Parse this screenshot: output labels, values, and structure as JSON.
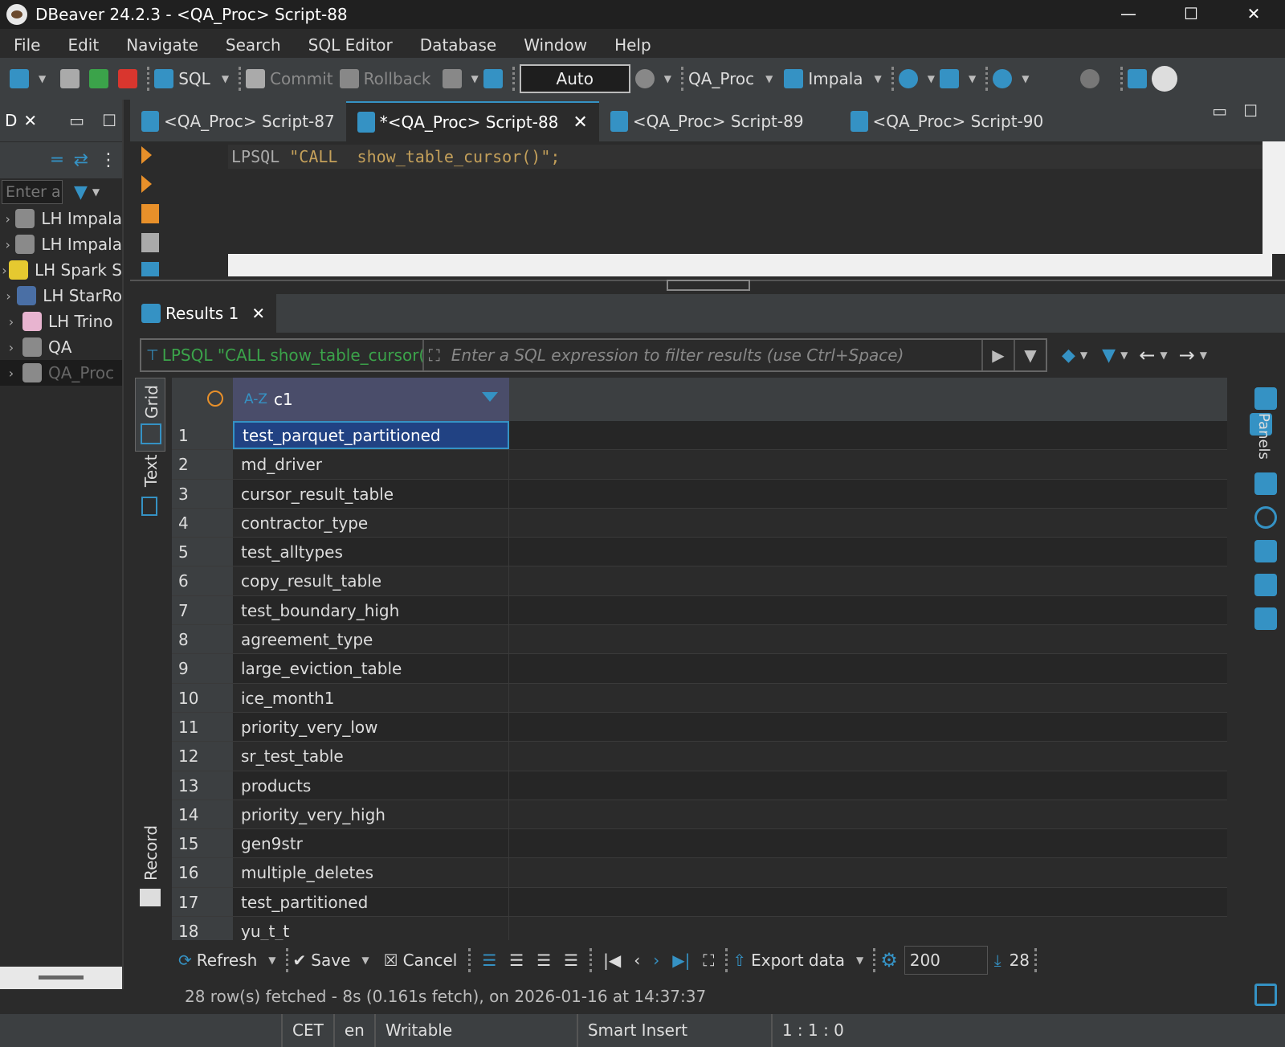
{
  "window": {
    "title": "DBeaver 24.2.3 - <QA_Proc> Script-88",
    "min": "—",
    "max": "☐",
    "close": "✕"
  },
  "menu": [
    "File",
    "Edit",
    "Navigate",
    "Search",
    "SQL Editor",
    "Database",
    "Window",
    "Help"
  ],
  "toolbar": {
    "sql": "SQL",
    "commit": "Commit",
    "rollback": "Rollback",
    "auto": "Auto",
    "datasource": "QA_Proc",
    "driver": "Impala"
  },
  "navigator": {
    "tab_label": "D",
    "filter_placeholder": "Enter a p",
    "items": [
      {
        "label": "LH Impala",
        "color": "#8a8a8a"
      },
      {
        "label": "LH Impala",
        "color": "#8a8a8a"
      },
      {
        "label": "LH Spark S",
        "color": "#e5c930"
      },
      {
        "label": "LH StarRo",
        "color": "#4a6fa5"
      },
      {
        "label": "LH Trino",
        "color": "#e8b4d0"
      },
      {
        "label": "QA",
        "color": "#8a8a8a"
      },
      {
        "label": "QA_Proc",
        "color": "#8a8a8a"
      }
    ]
  },
  "editor_tabs": [
    {
      "label": "<QA_Proc> Script-87",
      "active": false
    },
    {
      "label": "*<QA_Proc> Script-88",
      "active": true
    },
    {
      "label": "<QA_Proc> Script-89",
      "active": false
    },
    {
      "label": "<QA_Proc> Script-90",
      "active": false
    }
  ],
  "code": {
    "keyword": "LPSQL ",
    "string": "\"CALL  show_table_cursor()\";"
  },
  "results": {
    "tab_label": "Results 1",
    "query_label": "LPSQL \"CALL show_table_cursor()\"",
    "filter_placeholder": "Enter a SQL expression to filter results (use Ctrl+Space)",
    "column": "c1",
    "type_badge": "A-Z",
    "rows": [
      "test_parquet_partitioned",
      "md_driver",
      "cursor_result_table",
      "contractor_type",
      "test_alltypes",
      "copy_result_table",
      "test_boundary_high",
      "agreement_type",
      "large_eviction_table",
      "ice_month1",
      "priority_very_low",
      "sr_test_table",
      "products",
      "priority_very_high",
      "gen9str",
      "multiple_deletes",
      "test_partitioned",
      "yu_t_t"
    ],
    "vtabs": {
      "grid": "Grid",
      "text": "Text",
      "record": "Record"
    },
    "panels": "Panels"
  },
  "bottom": {
    "refresh": "Refresh",
    "save": "Save",
    "cancel": "Cancel",
    "export": "Export data",
    "fetch_size": "200",
    "count": "28"
  },
  "status_line": "28 row(s) fetched - 8s (0.161s fetch), on 2026-01-16 at 14:37:37",
  "statusbar": {
    "tz": "CET",
    "lang": "en",
    "mode": "Writable",
    "insert": "Smart Insert",
    "pos": "1 : 1 : 0"
  },
  "colors": {
    "accent": "#3592c4",
    "query_green": "#3ba34a",
    "selected_row": "#214283",
    "header_col": "#4a4d6a"
  }
}
